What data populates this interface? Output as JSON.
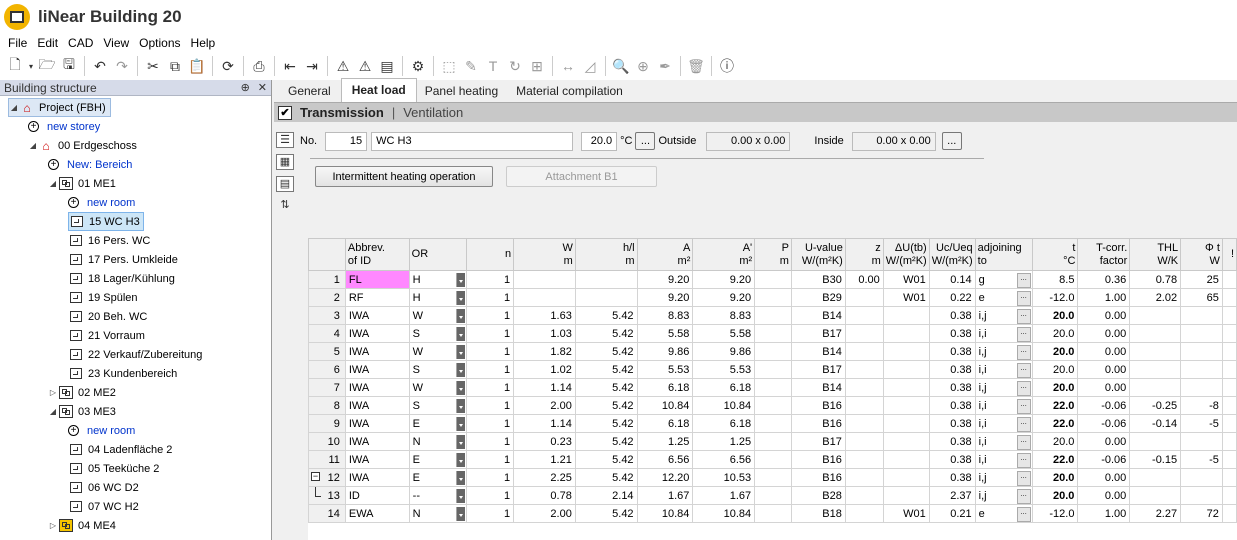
{
  "app": {
    "title": "liNear Building 20"
  },
  "menu": [
    "File",
    "Edit",
    "CAD",
    "View",
    "Options",
    "Help"
  ],
  "left_panel": {
    "title": "Building structure",
    "pin": "⊕",
    "close": "✕",
    "tree": [
      {
        "label": "Project (FBH)",
        "level": 0,
        "kind": "project",
        "expanded": true,
        "selected_style": true
      },
      {
        "label": "new storey",
        "level": 1,
        "kind": "link"
      },
      {
        "label": "00 Erdgeschoss",
        "level": 1,
        "kind": "storey",
        "expanded": true
      },
      {
        "label": "New: Bereich",
        "level": 2,
        "kind": "link"
      },
      {
        "label": "01 ME1",
        "level": 2,
        "kind": "unit",
        "expanded": true
      },
      {
        "label": "new room",
        "level": 3,
        "kind": "link"
      },
      {
        "label": "15 WC H3",
        "level": 3,
        "kind": "room",
        "selected": true
      },
      {
        "label": "16 Pers. WC",
        "level": 3,
        "kind": "room"
      },
      {
        "label": "17 Pers. Umkleide",
        "level": 3,
        "kind": "room"
      },
      {
        "label": "18 Lager/Kühlung",
        "level": 3,
        "kind": "room"
      },
      {
        "label": "19 Spülen",
        "level": 3,
        "kind": "room"
      },
      {
        "label": "20 Beh. WC",
        "level": 3,
        "kind": "room"
      },
      {
        "label": "21 Vorraum",
        "level": 3,
        "kind": "room"
      },
      {
        "label": "22 Verkauf/Zubereitung",
        "level": 3,
        "kind": "room"
      },
      {
        "label": "23 Kundenbereich",
        "level": 3,
        "kind": "room"
      },
      {
        "label": "02 ME2",
        "level": 2,
        "kind": "unit",
        "collapsed": true
      },
      {
        "label": "03 ME3",
        "level": 2,
        "kind": "unit",
        "expanded": true
      },
      {
        "label": "new room",
        "level": 3,
        "kind": "link"
      },
      {
        "label": "04 Ladenfläche 2",
        "level": 3,
        "kind": "room"
      },
      {
        "label": "05 Teeküche 2",
        "level": 3,
        "kind": "room"
      },
      {
        "label": "06 WC D2",
        "level": 3,
        "kind": "room"
      },
      {
        "label": "07 WC H2",
        "level": 3,
        "kind": "room"
      },
      {
        "label": "04 ME4",
        "level": 2,
        "kind": "unit-warn",
        "collapsed": true
      }
    ]
  },
  "tabs": [
    {
      "label": "General",
      "active": false
    },
    {
      "label": "Heat load",
      "active": true
    },
    {
      "label": "Panel heating",
      "active": false
    },
    {
      "label": "Material compilation",
      "active": false
    }
  ],
  "section": {
    "transmission": "Transmission",
    "divider": "|",
    "ventilation": "Ventilation",
    "checked": "✔"
  },
  "form": {
    "no_label": "No.",
    "no_value": "15",
    "name_value": "WC H3",
    "temp_value": "20.0",
    "temp_unit": "°C",
    "dots": "...",
    "outside_label": "Outside",
    "outside_value": "0.00 x 0.00",
    "inside_label": "Inside",
    "inside_value": "0.00 x 0.00"
  },
  "buttons": {
    "intermittent": "Intermittent heating operation",
    "attachment": "Attachment B1"
  },
  "grid": {
    "headers": [
      [
        "",
        ""
      ],
      [
        "Abbrev.",
        "of ID"
      ],
      [
        "OR",
        ""
      ],
      [
        "n",
        ""
      ],
      [
        "W",
        "m"
      ],
      [
        "h/l",
        "m"
      ],
      [
        "A",
        "m²"
      ],
      [
        "A'",
        "m²"
      ],
      [
        "P",
        "m"
      ],
      [
        "U-value",
        "W/(m²K)"
      ],
      [
        "z",
        "m"
      ],
      [
        "ΔU(tb)",
        "W/(m²K)"
      ],
      [
        "Uc/Ueq",
        "W/(m²K)"
      ],
      [
        "adjoining",
        "to"
      ],
      [
        "t",
        "°C"
      ],
      [
        "T-corr.",
        "factor"
      ],
      [
        "THL",
        "W/K"
      ],
      [
        "Φ t",
        "W"
      ],
      [
        "!",
        ""
      ]
    ],
    "rows": [
      {
        "n": "1",
        "abbr": "FL",
        "or": "H",
        "cnt": "1",
        "w": "",
        "h": "",
        "a": "9.20",
        "a2": "9.20",
        "p": "",
        "u": "B30",
        "z": "0.00",
        "du": "W01",
        "uc": "0.14",
        "adj": "g",
        "t": "8.5",
        "tc": "0.36",
        "thl": "0.78",
        "phi": "25",
        "pink": true
      },
      {
        "n": "2",
        "abbr": "RF",
        "or": "H",
        "cnt": "1",
        "w": "",
        "h": "",
        "a": "9.20",
        "a2": "9.20",
        "p": "",
        "u": "B29",
        "z": "",
        "du": "W01",
        "uc": "0.22",
        "adj": "e",
        "t": "-12.0",
        "tc": "1.00",
        "thl": "2.02",
        "phi": "65"
      },
      {
        "n": "3",
        "abbr": "IWA",
        "or": "W",
        "cnt": "1",
        "w": "1.63",
        "h": "5.42",
        "a": "8.83",
        "a2": "8.83",
        "p": "",
        "u": "B14",
        "z": "",
        "du": "",
        "uc": "0.38",
        "adj": "i,j",
        "t": "20.0",
        "tbold": true,
        "tc": "0.00",
        "thl": "",
        "phi": ""
      },
      {
        "n": "4",
        "abbr": "IWA",
        "or": "S",
        "cnt": "1",
        "w": "1.03",
        "h": "5.42",
        "a": "5.58",
        "a2": "5.58",
        "p": "",
        "u": "B17",
        "z": "",
        "du": "",
        "uc": "0.38",
        "adj": "i,i",
        "t": "20.0",
        "tc": "0.00",
        "thl": "",
        "phi": ""
      },
      {
        "n": "5",
        "abbr": "IWA",
        "or": "W",
        "cnt": "1",
        "w": "1.82",
        "h": "5.42",
        "a": "9.86",
        "a2": "9.86",
        "p": "",
        "u": "B14",
        "z": "",
        "du": "",
        "uc": "0.38",
        "adj": "i,j",
        "t": "20.0",
        "tbold": true,
        "tc": "0.00",
        "thl": "",
        "phi": ""
      },
      {
        "n": "6",
        "abbr": "IWA",
        "or": "S",
        "cnt": "1",
        "w": "1.02",
        "h": "5.42",
        "a": "5.53",
        "a2": "5.53",
        "p": "",
        "u": "B17",
        "z": "",
        "du": "",
        "uc": "0.38",
        "adj": "i,i",
        "t": "20.0",
        "tc": "0.00",
        "thl": "",
        "phi": ""
      },
      {
        "n": "7",
        "abbr": "IWA",
        "or": "W",
        "cnt": "1",
        "w": "1.14",
        "h": "5.42",
        "a": "6.18",
        "a2": "6.18",
        "p": "",
        "u": "B14",
        "z": "",
        "du": "",
        "uc": "0.38",
        "adj": "i,j",
        "t": "20.0",
        "tbold": true,
        "tc": "0.00",
        "thl": "",
        "phi": ""
      },
      {
        "n": "8",
        "abbr": "IWA",
        "or": "S",
        "cnt": "1",
        "w": "2.00",
        "h": "5.42",
        "a": "10.84",
        "a2": "10.84",
        "p": "",
        "u": "B16",
        "z": "",
        "du": "",
        "uc": "0.38",
        "adj": "i,i",
        "t": "22.0",
        "tbold": true,
        "tc": "-0.06",
        "thl": "-0.25",
        "phi": "-8"
      },
      {
        "n": "9",
        "abbr": "IWA",
        "or": "E",
        "cnt": "1",
        "w": "1.14",
        "h": "5.42",
        "a": "6.18",
        "a2": "6.18",
        "p": "",
        "u": "B16",
        "z": "",
        "du": "",
        "uc": "0.38",
        "adj": "i,i",
        "t": "22.0",
        "tbold": true,
        "tc": "-0.06",
        "thl": "-0.14",
        "phi": "-5"
      },
      {
        "n": "10",
        "abbr": "IWA",
        "or": "N",
        "cnt": "1",
        "w": "0.23",
        "h": "5.42",
        "a": "1.25",
        "a2": "1.25",
        "p": "",
        "u": "B17",
        "z": "",
        "du": "",
        "uc": "0.38",
        "adj": "i,i",
        "t": "20.0",
        "tc": "0.00",
        "thl": "",
        "phi": ""
      },
      {
        "n": "11",
        "abbr": "IWA",
        "or": "E",
        "cnt": "1",
        "w": "1.21",
        "h": "5.42",
        "a": "6.56",
        "a2": "6.56",
        "p": "",
        "u": "B16",
        "z": "",
        "du": "",
        "uc": "0.38",
        "adj": "i,i",
        "t": "22.0",
        "tbold": true,
        "tc": "-0.06",
        "thl": "-0.15",
        "phi": "-5"
      },
      {
        "n": "12",
        "abbr": "IWA",
        "or": "E",
        "cnt": "1",
        "w": "2.25",
        "h": "5.42",
        "a": "12.20",
        "a2": "10.53",
        "p": "",
        "u": "B16",
        "z": "",
        "du": "",
        "uc": "0.38",
        "adj": "i,j",
        "t": "20.0",
        "tbold": true,
        "tc": "0.00",
        "thl": "",
        "phi": "",
        "group": "minus"
      },
      {
        "n": "13",
        "abbr": "ID",
        "or": "--",
        "cnt": "1",
        "w": "0.78",
        "h": "2.14",
        "a": "1.67",
        "a2": "1.67",
        "p": "",
        "u": "B28",
        "z": "",
        "du": "",
        "uc": "2.37",
        "adj": "i,j",
        "t": "20.0",
        "tbold": true,
        "tc": "0.00",
        "thl": "",
        "phi": "",
        "group": "child"
      },
      {
        "n": "14",
        "abbr": "EWA",
        "or": "N",
        "cnt": "1",
        "w": "2.00",
        "h": "5.42",
        "a": "10.84",
        "a2": "10.84",
        "p": "",
        "u": "B18",
        "z": "",
        "du": "W01",
        "uc": "0.21",
        "adj": "e",
        "t": "-12.0",
        "tc": "1.00",
        "thl": "2.27",
        "phi": "72"
      }
    ]
  }
}
